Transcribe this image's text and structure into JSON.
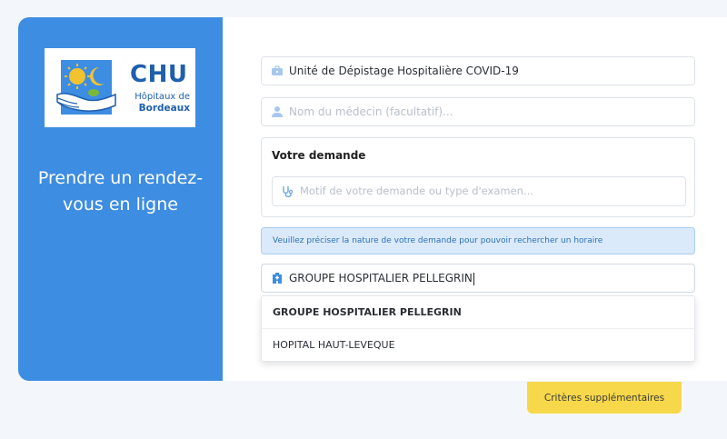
{
  "logo": {
    "brand": "CHU",
    "line1": "Hôpitaux de",
    "line2": "Bordeaux"
  },
  "left_panel": {
    "title_line1": "Prendre un rendez-",
    "title_line2": "vous en ligne"
  },
  "form": {
    "unit_value": "Unité de Dépistage Hospitalière COVID-19",
    "doctor_placeholder": "Nom du médecin (facultatif)...",
    "demande_title": "Votre demande",
    "motif_placeholder": "Motif de votre demande ou type d'examen...",
    "info_message": "Veuillez préciser la nature de votre demande pour pouvoir rechercher un horaire",
    "hospital_value": "GROUPE HOSPITALIER PELLEGRIN"
  },
  "dropdown": {
    "options": [
      "GROUPE HOSPITALIER PELLEGRIN",
      "HOPITAL HAUT-LEVEQUE"
    ]
  },
  "buttons": {
    "criteria_label": "Critères supplémentaires"
  },
  "colors": {
    "panel_blue": "#3d8de2",
    "accent_yellow": "#f7d84a",
    "info_bg": "#dbeafb",
    "logo_blue": "#1f5fad"
  },
  "icons": [
    "briefcase-icon",
    "doctor-icon",
    "stethoscope-icon",
    "hospital-icon"
  ]
}
